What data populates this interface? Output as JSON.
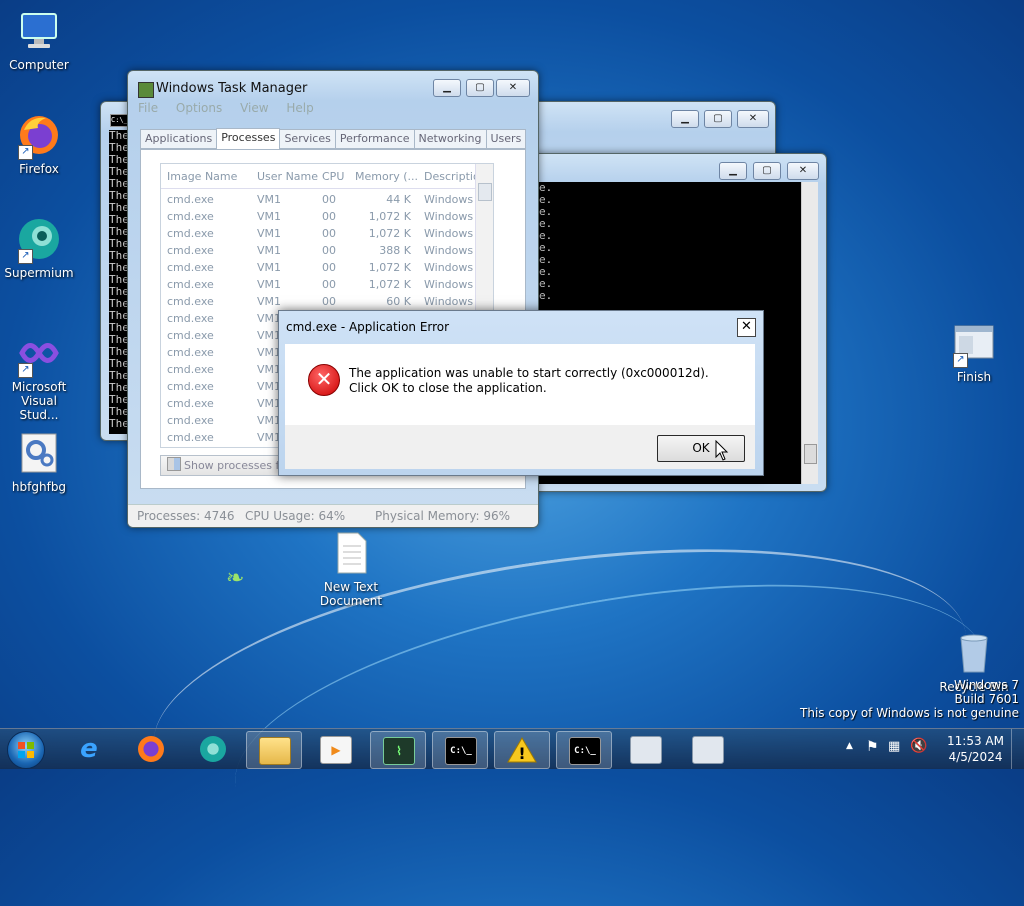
{
  "desktop": {
    "icons": [
      {
        "label": "Computer"
      },
      {
        "label": "Firefox"
      },
      {
        "label": "Supermium"
      },
      {
        "label": "Microsoft Visual Stud..."
      },
      {
        "label": "hbfghfbg"
      },
      {
        "label": "New Text Document"
      },
      {
        "label": "Finish"
      },
      {
        "label": "Recycle Bin"
      }
    ],
    "watermark": {
      "line1": "Windows 7",
      "line2": "Build 7601",
      "line3": "This copy of Windows is not genuine"
    }
  },
  "console_back": {
    "title_icon": "C:\\_",
    "lines": [
      "The",
      "The",
      "The",
      "The",
      "The",
      "The",
      "The",
      "The",
      "The",
      "The",
      "The",
      "The",
      "The",
      "The",
      "The",
      "The",
      "The",
      "The",
      "The",
      "The",
      "The",
      "The",
      "The",
      "The",
      "The"
    ]
  },
  "console_front": {
    "lines": [
      "e.",
      "e.",
      "e.",
      "e.",
      "e.",
      "e.",
      "e.",
      "e.",
      "e.",
      "e."
    ]
  },
  "task_manager": {
    "title": "Windows Task Manager",
    "menu": [
      "File",
      "Options",
      "View",
      "Help"
    ],
    "tabs": [
      "Applications",
      "Processes",
      "Services",
      "Performance",
      "Networking",
      "Users"
    ],
    "active_tab": "Processes",
    "columns": [
      "Image Name",
      "User Name",
      "CPU",
      "Memory (...",
      "Description"
    ],
    "rows": [
      {
        "name": "cmd.exe",
        "user": "VM1",
        "cpu": "00",
        "mem": "44 K",
        "desc": "Windows ..."
      },
      {
        "name": "cmd.exe",
        "user": "VM1",
        "cpu": "00",
        "mem": "1,072 K",
        "desc": "Windows ..."
      },
      {
        "name": "cmd.exe",
        "user": "VM1",
        "cpu": "00",
        "mem": "1,072 K",
        "desc": "Windows ..."
      },
      {
        "name": "cmd.exe",
        "user": "VM1",
        "cpu": "00",
        "mem": "388 K",
        "desc": "Windows ..."
      },
      {
        "name": "cmd.exe",
        "user": "VM1",
        "cpu": "00",
        "mem": "1,072 K",
        "desc": "Windows ..."
      },
      {
        "name": "cmd.exe",
        "user": "VM1",
        "cpu": "00",
        "mem": "1,072 K",
        "desc": "Windows ..."
      },
      {
        "name": "cmd.exe",
        "user": "VM1",
        "cpu": "00",
        "mem": "60 K",
        "desc": "Windows ..."
      },
      {
        "name": "cmd.exe",
        "user": "VM1",
        "cpu": "",
        "mem": "",
        "desc": ""
      },
      {
        "name": "cmd.exe",
        "user": "VM1",
        "cpu": "",
        "mem": "",
        "desc": ""
      },
      {
        "name": "cmd.exe",
        "user": "VM1",
        "cpu": "",
        "mem": "",
        "desc": ""
      },
      {
        "name": "cmd.exe",
        "user": "VM1",
        "cpu": "",
        "mem": "",
        "desc": ""
      },
      {
        "name": "cmd.exe",
        "user": "VM1",
        "cpu": "",
        "mem": "",
        "desc": ""
      },
      {
        "name": "cmd.exe",
        "user": "VM1",
        "cpu": "",
        "mem": "",
        "desc": ""
      },
      {
        "name": "cmd.exe",
        "user": "VM1",
        "cpu": "",
        "mem": "",
        "desc": ""
      },
      {
        "name": "cmd.exe",
        "user": "VM1",
        "cpu": "",
        "mem": "",
        "desc": ""
      }
    ],
    "show_processes_label": "Show processes fro",
    "status": {
      "processes": "Processes: 4746",
      "cpu": "CPU Usage: 64%",
      "memory": "Physical Memory: 96%"
    }
  },
  "dialog": {
    "title": "cmd.exe - Application Error",
    "close_label": "✕",
    "message": "The application was unable to start correctly (0xc000012d). Click OK to close the application.",
    "ok_label": "OK"
  },
  "window_controls": {
    "min": "▁",
    "max": "▢",
    "close": "✕"
  },
  "taskbar": {
    "start_icon": "windows-orb",
    "items": [
      "internet-explorer-icon",
      "firefox-icon",
      "supermium-icon",
      "file-explorer-icon",
      "media-player-icon",
      "task-manager-icon",
      "cmd-icon",
      "warning-icon",
      "cmd-icon",
      "window-icon",
      "window-icon"
    ],
    "cmd_glyph": "C:\\_",
    "warn_glyph": "!",
    "clock_time": "11:53 AM",
    "clock_date": "4/5/2024",
    "tray_arrow": "▲"
  }
}
